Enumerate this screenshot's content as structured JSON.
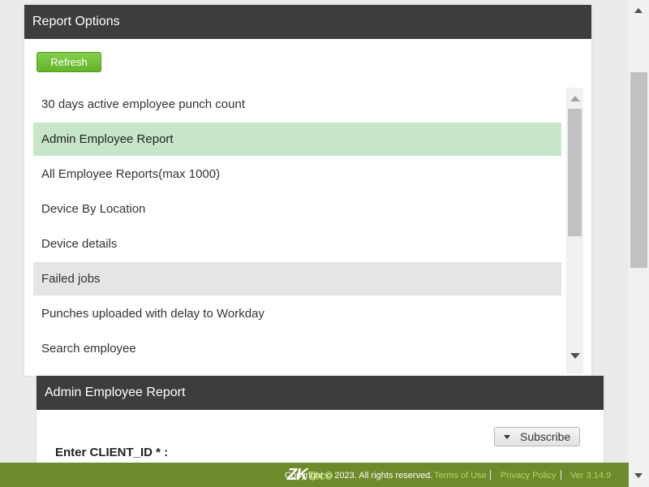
{
  "report_options": {
    "title": "Report Options",
    "refresh_label": "Refresh",
    "items": [
      {
        "label": "30 days active employee punch count"
      },
      {
        "label": "Admin Employee Report"
      },
      {
        "label": "All Employee Reports(max 1000)"
      },
      {
        "label": "Device By Location"
      },
      {
        "label": "Device details"
      },
      {
        "label": "Failed jobs"
      },
      {
        "label": "Punches uploaded with delay to Workday"
      },
      {
        "label": "Search employee"
      }
    ],
    "selected_item": "Admin Employee Report",
    "hovered_item": "Failed jobs"
  },
  "report_detail": {
    "title": "Admin Employee Report",
    "subscribe_label": "Subscribe",
    "client_id_label": "Enter CLIENT_ID * :"
  },
  "footer": {
    "logo_text": "ZK",
    "logo_tail": "Teco",
    "copyright": "Copyright © 2023. All rights reserved.",
    "terms_label": "Terms of Use",
    "privacy_label": "Privacy Policy",
    "version": "Ver 3.14.9"
  },
  "colors": {
    "header_bg": "#3b3d3f",
    "refresh_green": "#6cbf35",
    "selected_row": "#c7e6c7",
    "hovered_row": "#e5e5e5",
    "footer_bg": "#6d8a2c",
    "footer_link": "#b5d65e"
  }
}
